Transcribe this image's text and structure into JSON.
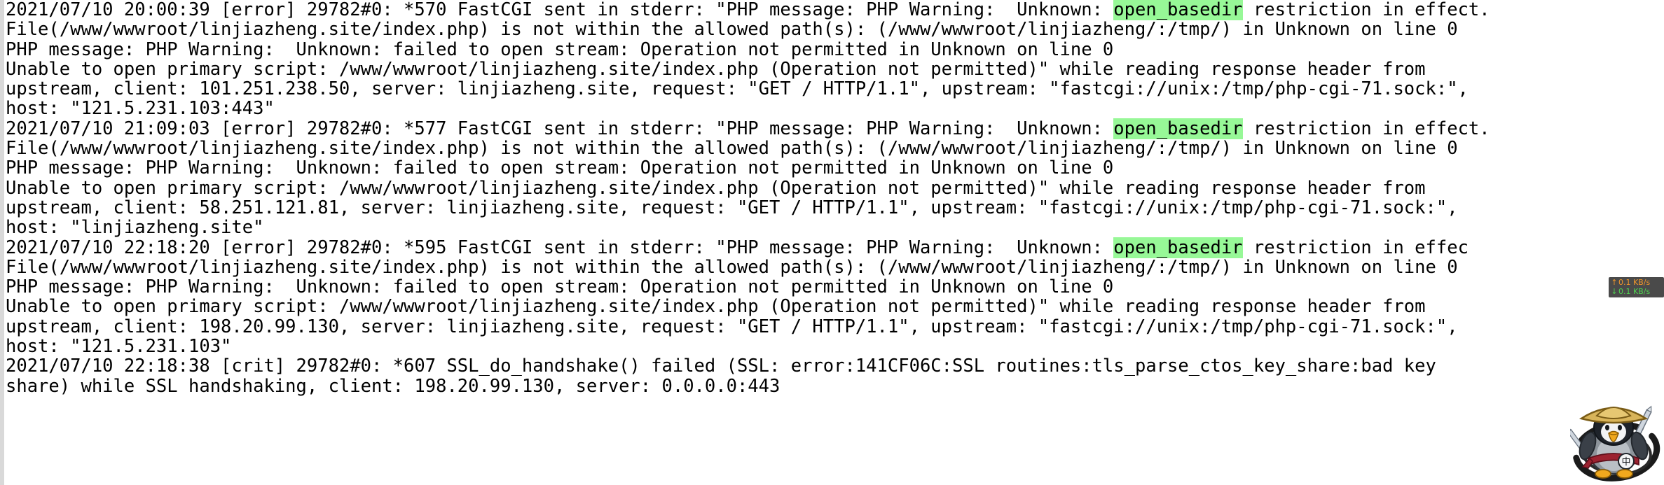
{
  "app": {
    "type": "log-file-viewer",
    "background_color": "#ffffff",
    "text_color": "#000000",
    "highlight_color": "#97f897",
    "gutter_color": "#d9d9d9"
  },
  "search": {
    "highlighted_term": "open_basedir",
    "match_count": 3
  },
  "log": {
    "lines": [
      {
        "segments": [
          {
            "text": "2021/07/10 20:00:39 [error] 29782#0: *570 FastCGI sent in stderr: \"PHP message: PHP Warning:  Unknown: "
          },
          {
            "text": "open_basedir",
            "highlight": true
          },
          {
            "text": " restriction in effect."
          }
        ]
      },
      {
        "segments": [
          {
            "text": "File(/www/wwwroot/linjiazheng.site/index.php) is not within the allowed path(s): (/www/wwwroot/linjiazheng/:/tmp/) in Unknown on line 0"
          }
        ]
      },
      {
        "segments": [
          {
            "text": "PHP message: PHP Warning:  Unknown: failed to open stream: Operation not permitted in Unknown on line 0"
          }
        ]
      },
      {
        "segments": [
          {
            "text": "Unable to open primary script: /www/wwwroot/linjiazheng.site/index.php (Operation not permitted)\" while reading response header from"
          }
        ]
      },
      {
        "segments": [
          {
            "text": "upstream, client: 101.251.238.50, server: linjiazheng.site, request: \"GET / HTTP/1.1\", upstream: \"fastcgi://unix:/tmp/php-cgi-71.sock:\","
          }
        ]
      },
      {
        "segments": [
          {
            "text": "host: \"121.5.231.103:443\""
          }
        ]
      },
      {
        "segments": [
          {
            "text": "2021/07/10 21:09:03 [error] 29782#0: *577 FastCGI sent in stderr: \"PHP message: PHP Warning:  Unknown: "
          },
          {
            "text": "open_basedir",
            "highlight": true
          },
          {
            "text": " restriction in effect."
          }
        ]
      },
      {
        "segments": [
          {
            "text": "File(/www/wwwroot/linjiazheng.site/index.php) is not within the allowed path(s): (/www/wwwroot/linjiazheng/:/tmp/) in Unknown on line 0"
          }
        ]
      },
      {
        "segments": [
          {
            "text": "PHP message: PHP Warning:  Unknown: failed to open stream: Operation not permitted in Unknown on line 0"
          }
        ]
      },
      {
        "segments": [
          {
            "text": "Unable to open primary script: /www/wwwroot/linjiazheng.site/index.php (Operation not permitted)\" while reading response header from"
          }
        ]
      },
      {
        "segments": [
          {
            "text": "upstream, client: 58.251.121.81, server: linjiazheng.site, request: \"GET / HTTP/1.1\", upstream: \"fastcgi://unix:/tmp/php-cgi-71.sock:\","
          }
        ]
      },
      {
        "segments": [
          {
            "text": "host: \"linjiazheng.site\""
          }
        ]
      },
      {
        "segments": [
          {
            "text": "2021/07/10 22:18:20 [error] 29782#0: *595 FastCGI sent in stderr: \"PHP message: PHP Warning:  Unknown: "
          },
          {
            "text": "open_basedir",
            "highlight": true
          },
          {
            "text": " restriction in effec"
          }
        ]
      },
      {
        "segments": [
          {
            "text": "File(/www/wwwroot/linjiazheng.site/index.php) is not within the allowed path(s): (/www/wwwroot/linjiazheng/:/tmp/) in Unknown on line 0"
          }
        ]
      },
      {
        "segments": [
          {
            "text": "PHP message: PHP Warning:  Unknown: failed to open stream: Operation not permitted in Unknown on line 0"
          }
        ]
      },
      {
        "segments": [
          {
            "text": "Unable to open primary script: /www/wwwroot/linjiazheng.site/index.php (Operation not permitted)\" while reading response header from"
          }
        ]
      },
      {
        "segments": [
          {
            "text": "upstream, client: 198.20.99.130, server: linjiazheng.site, request: \"GET / HTTP/1.1\", upstream: \"fastcgi://unix:/tmp/php-cgi-71.sock:\","
          }
        ]
      },
      {
        "segments": [
          {
            "text": "host: \"121.5.231.103\""
          }
        ]
      },
      {
        "segments": [
          {
            "text": "2021/07/10 22:18:38 [crit] 29782#0: *607 SSL_do_handshake() failed (SSL: error:141CF06C:SSL routines:tls_parse_ctos_key_share:bad key"
          }
        ]
      },
      {
        "segments": [
          {
            "text": "share) while SSL handshaking, client: 198.20.99.130, server: 0.0.0.0:443"
          }
        ]
      }
    ]
  },
  "net_speed_widget": {
    "upload_arrow": "↑",
    "upload_value": "0.1 KB/s",
    "download_arrow": "↓",
    "download_value": "0.1 KB/s",
    "upload_color": "#f0952a",
    "download_color": "#4fd24f",
    "background_color": "#4a4a4a"
  },
  "avatar_watermark": {
    "description": "cartoon penguin samurai avatar with sword and brush-stroke ring",
    "badge_text": "中"
  }
}
